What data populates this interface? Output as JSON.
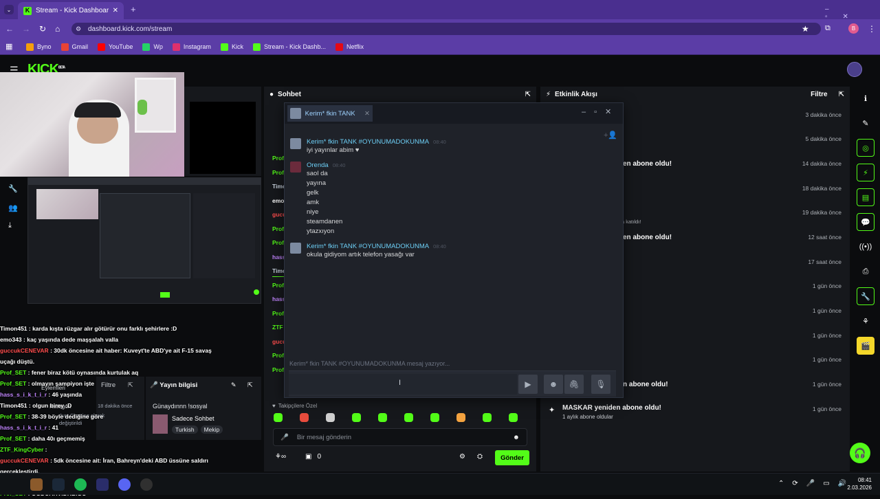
{
  "browser": {
    "tab_title": "Stream - Kick Dashboard",
    "url": "dashboard.kick.com/stream",
    "profile_initial": "B",
    "bookmarks": [
      {
        "label": "Byno",
        "color": "#f59e0b"
      },
      {
        "label": "Gmail",
        "color": "#ea4335"
      },
      {
        "label": "YouTube",
        "color": "#ff0000"
      },
      {
        "label": "Wp",
        "color": "#25d366"
      },
      {
        "label": "Instagram",
        "color": "#e1306c"
      },
      {
        "label": "Kick",
        "color": "#53fc18"
      },
      {
        "label": "Stream - Kick Dashb...",
        "color": "#53fc18"
      },
      {
        "label": "Netflix",
        "color": "#e50914"
      }
    ]
  },
  "dashboard": {
    "logo": "KICK",
    "logo_badge": "BETA",
    "chat_title": "Sohbet",
    "activity_title": "Etkinlik Akışı",
    "activity_filter": "Filtre",
    "chat_input_placeholder": "Bir mesaj gönderin",
    "send_button": "Gönder",
    "followers_only": "Takipçilere Özel",
    "viewer_count": "0",
    "stream_info_title": "Yayın bilgisi",
    "stream_info_filter": "Filtre",
    "stream_title": "Günaydınnn !sosyal",
    "stream_category": "Sadece Sohbet",
    "stream_tags": [
      "Turkish",
      "Mekip"
    ],
    "partial_actions": "Eylemleri",
    "partial_category": "Kategori",
    "partial_time": "18 dakika önce",
    "partial_changed": "Just Chatting olarak değiştirildi",
    "partial_joined": "a katıldı!",
    "activity": [
      {
        "text": "",
        "time": "3 dakika önce"
      },
      {
        "text": "",
        "time": "5 dakika önce"
      },
      {
        "text": "en abone oldu!",
        "time": "14 dakika önce"
      },
      {
        "text": "",
        "time": "18 dakika önce"
      },
      {
        "text": "",
        "time": "19 dakika önce"
      },
      {
        "text": "en abone oldu!",
        "time": "12 saat önce"
      },
      {
        "text": "",
        "time": "17 saat önce"
      },
      {
        "text": "",
        "time": "1 gün önce"
      },
      {
        "text": "",
        "time": "1 gün önce"
      },
      {
        "text": "",
        "time": "1 gün önce"
      },
      {
        "text": "",
        "time": "1 gün önce"
      },
      {
        "text": "n abone oldu!",
        "time": "1 gün önce"
      }
    ],
    "last_activity": {
      "text": "MASKAR yeniden abone oldu!",
      "sub": "1 aylık abone oldular",
      "time": "1 gün önce"
    }
  },
  "steam_chat": {
    "tab_label": "Kerim* fkin TANK",
    "typing_text": "Kerim* fkin TANK #OYUNUMADOKUNMA mesaj yazıyor...",
    "messages": [
      {
        "name": "Kerim* fkin TANK #OYUNUMADOKUNMA",
        "time": "08:40",
        "lines": [
          "iyi yayınlar abim ♥"
        ]
      },
      {
        "name": "Orenda",
        "time": "08:40",
        "lines": [
          "saol da",
          "yayına",
          "gelk",
          "amk",
          "niye",
          "steamdanen",
          "ytazxıyon"
        ]
      },
      {
        "name": "Kerim* fkin TANK #OYUNUMADOKUNMA",
        "time": "08:40",
        "lines": [
          "okula gidiyom artık telefon yasağı var"
        ]
      }
    ]
  },
  "overlay_chat": [
    {
      "name": "Timon451",
      "color": "#ffffff",
      "text": " : karda kışta rüzgar alır götürür onu farklı şehirlere :D"
    },
    {
      "name": "emo343",
      "color": "#ffffff",
      "text": " : kaç yaşında dede maşşalah valla"
    },
    {
      "name": "guccukCENEVAR",
      "color": "#ff4d4d",
      "text": " : 30dk öncesine ait haber: Kuveyt'te ABD'ye ait F-15 savaş"
    },
    {
      "name": "",
      "color": "#ffffff",
      "text": "uçağı düştü."
    },
    {
      "name": "Prof_SET",
      "color": "#53fc18",
      "text": " : fener biraz kötü oynasında kurtulak aq"
    },
    {
      "name": "Prof_SET",
      "color": "#53fc18",
      "text": " : olmayın şampiyon işte"
    },
    {
      "name": "hass_s_i_k_t_i_r",
      "color": "#c084fc",
      "text": " : 46 yaşında"
    },
    {
      "name": "Timon451",
      "color": "#ffffff",
      "text": " : olgun birey :D"
    },
    {
      "name": "Prof_SET",
      "color": "#53fc18",
      "text": " : 38-39 böyle dediğine göre"
    },
    {
      "name": "hass_s_i_k_t_i_r",
      "color": "#c084fc",
      "text": " : 41"
    },
    {
      "name": "Prof_SET",
      "color": "#53fc18",
      "text": " : daha 40ı geçmemiş"
    },
    {
      "name": "ZTF_KingCyber",
      "color": "#53fc18",
      "text": " : "
    },
    {
      "name": "guccukCENEVAR",
      "color": "#ff4d4d",
      "text": " : 5dk öncesine ait: İran, Bahreyn'deki ABD üssüne saldırı"
    },
    {
      "name": "",
      "color": "#ffffff",
      "text": "gerçekleştirdi."
    },
    {
      "name": "Prof_SET",
      "color": "#53fc18",
      "text": " : "
    },
    {
      "name": "Prof_SET",
      "color": "#53fc18",
      "text": " : OGDUAHVIDHBIGO"
    }
  ],
  "chat_names_partial": [
    "Prof",
    "Prof",
    "Timo",
    "emo",
    "gucu",
    "Prof",
    "Prof",
    "hass",
    "Timo",
    "Prof",
    "hass",
    "Prof",
    "ZTF",
    "gucu",
    "Prof",
    "Prof"
  ],
  "taskbar": {
    "time": "08:41",
    "date": "2.03.2026"
  },
  "colors": {
    "kick_green": "#53fc18",
    "browser_purple": "#5b3da6",
    "steam_bg": "#1f2229"
  }
}
